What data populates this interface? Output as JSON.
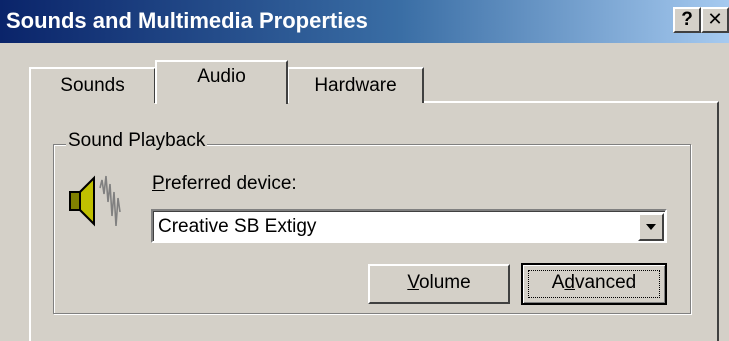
{
  "window": {
    "title": "Sounds and Multimedia Properties",
    "help_label": "?",
    "close_label": "✕"
  },
  "tabs": [
    {
      "label": "Sounds",
      "selected": false
    },
    {
      "label": "Audio",
      "selected": true
    },
    {
      "label": "Hardware",
      "selected": false
    }
  ],
  "sound_playback": {
    "group_label": "Sound Playback",
    "device_label_mnemonic": "P",
    "device_label_rest": "referred device:",
    "selected_device": "Creative SB Extigy",
    "icon": "speaker-icon",
    "volume_mnemonic": "V",
    "volume_rest": "olume",
    "advanced_first": "A",
    "advanced_mnemonic": "d",
    "advanced_rest": "vanced"
  },
  "colors": {
    "titlebar_start": "#0a246a",
    "titlebar_end": "#a6caf0",
    "face": "#d4d0c8"
  }
}
